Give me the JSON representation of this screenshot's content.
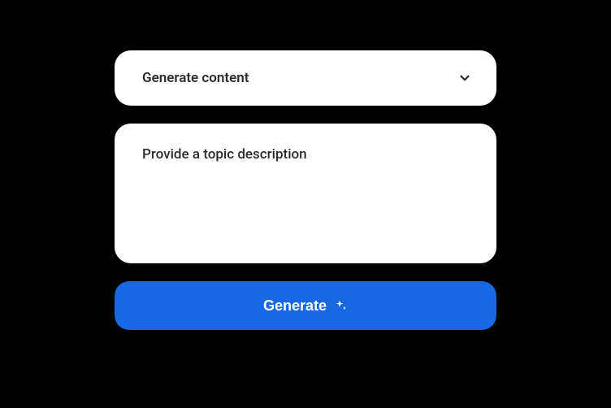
{
  "dropdown": {
    "label": "Generate content"
  },
  "textarea": {
    "placeholder": "Provide a topic description"
  },
  "button": {
    "label": "Generate"
  }
}
